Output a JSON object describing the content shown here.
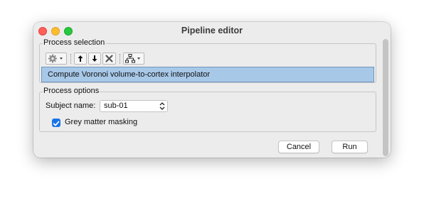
{
  "window": {
    "title": "Pipeline editor"
  },
  "process_selection": {
    "label": "Process selection",
    "toolbar": {
      "icons": [
        "gear-icon",
        "chevron-down-icon",
        "arrow-up-icon",
        "arrow-down-icon",
        "delete-x-icon",
        "tree-icon",
        "chevron-down-icon"
      ]
    },
    "selected_process": "Compute Voronoi volume-to-cortex interpolator"
  },
  "process_options": {
    "label": "Process options",
    "subject": {
      "label": "Subject name:",
      "value": "sub-01"
    },
    "grey_matter": {
      "label": "Grey matter masking",
      "checked": true
    }
  },
  "buttons": {
    "cancel": "Cancel",
    "run": "Run"
  },
  "colors": {
    "selection_bg": "#a8c8e8",
    "checkbox_accent": "#1a73e8",
    "traffic_close": "#ff5f57",
    "traffic_min": "#febc2e",
    "traffic_max": "#28c840"
  }
}
